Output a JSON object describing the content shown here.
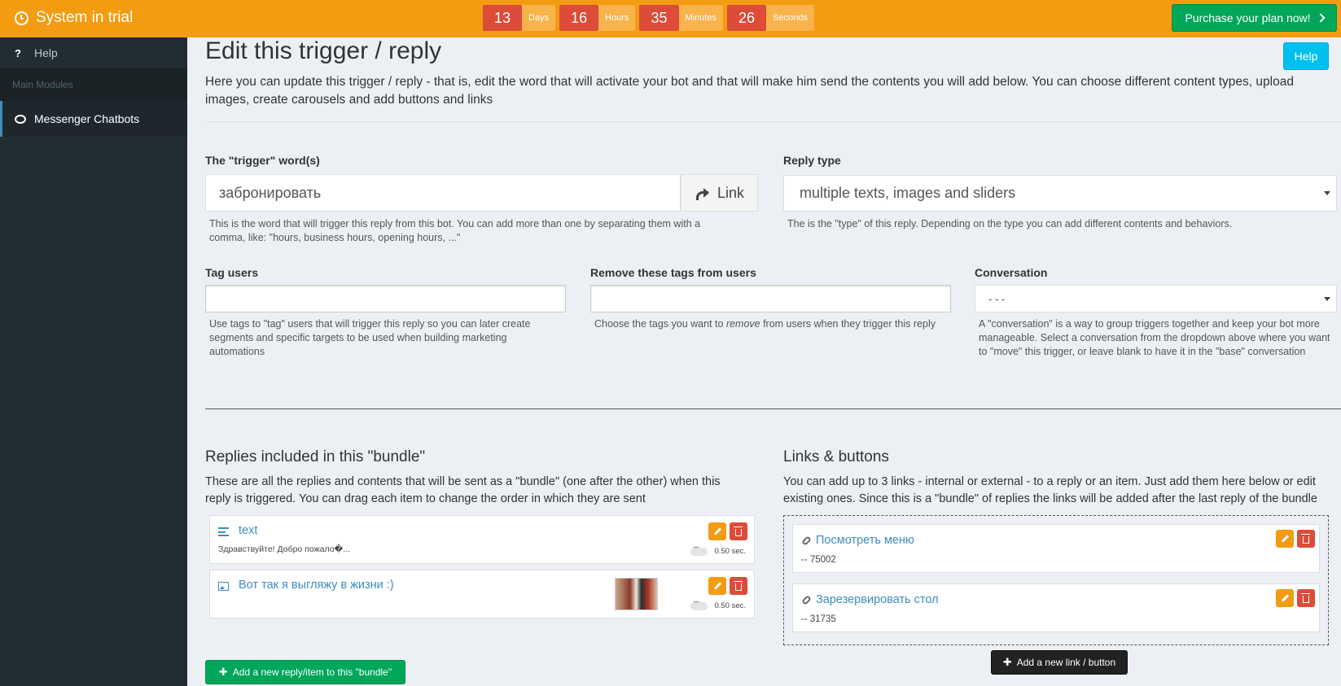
{
  "topbar": {
    "title": "System in trial",
    "countdown": [
      {
        "value": "13",
        "unit": "Days"
      },
      {
        "value": "16",
        "unit": "Hours"
      },
      {
        "value": "35",
        "unit": "Minutes"
      },
      {
        "value": "26",
        "unit": "Seconds"
      }
    ],
    "purchase_label": "Purchase your plan now!"
  },
  "sidebar": {
    "help_label": "Help",
    "header": "Main Modules",
    "active_item": "Messenger Chatbots"
  },
  "page": {
    "title": "Edit this trigger / reply",
    "help_button": "Help",
    "description": "Here you can update this trigger / reply - that is, edit the word that will activate your bot and that will make him send the contents you will add below. You can choose different content types, upload images, create carousels and add buttons and links"
  },
  "form": {
    "trigger_label": "The \"trigger\" word(s)",
    "trigger_value": "забронировать",
    "link_button": "Link",
    "trigger_hint": "This is the word that will trigger this reply from this bot. You can add more than one by separating them with a comma, like: \"hours, business hours, opening hours, ...\"",
    "reply_type_label": "Reply type",
    "reply_type_value": "multiple texts, images and sliders",
    "reply_type_hint": "The is the \"type\" of this reply. Depending on the type you can add different contents and behaviors.",
    "tag_users_label": "Tag users",
    "tag_users_hint": "Use tags to \"tag\" users that will trigger this reply so you can later create segments and specific targets to be used when building marketing automations",
    "remove_tags_label": "Remove these tags from users",
    "remove_tags_hint_pre": "Choose the tags you want to ",
    "remove_tags_hint_em": "remove",
    "remove_tags_hint_post": " from users when they trigger this reply",
    "conversation_label": "Conversation",
    "conversation_value": "- - -",
    "conversation_hint": "A \"conversation\" is a way to group triggers together and keep your bot more manageable. Select a conversation from the dropdown above where you want to \"move\" this trigger, or leave blank to have it in the \"base\" conversation"
  },
  "bundle": {
    "title": "Replies included in this \"bundle\"",
    "description": "These are all the replies and contents that will be sent as a \"bundle\" (one after the other) when this reply is triggered. You can drag each item to change the order in which they are sent",
    "items": [
      {
        "icon": "text-lines-icon",
        "title": "text",
        "subtitle": "Здравствуйте! Добро пожало�...",
        "delay": "0.50 sec."
      },
      {
        "icon": "image-icon",
        "title": "Вот так я выгляжу в жизни :)",
        "subtitle": "",
        "delay": "0.50 sec."
      }
    ],
    "add_button": "Add a new reply/item to this \"bundle\""
  },
  "links": {
    "title": "Links & buttons",
    "description": "You can add up to 3 links - internal or external - to a reply or an item. Just add them here below or edit existing ones. Since this is a \"bundle\" of replies the links will be added after the last reply of the bundle",
    "items": [
      {
        "title": "Посмотреть меню",
        "subtitle": "-- 75002"
      },
      {
        "title": "Зарезервировать стол",
        "subtitle": "-- 31735"
      }
    ],
    "add_button": "Add a new link / button"
  },
  "colors": {
    "topbar": "#f39c12",
    "sidebar": "#222d32",
    "accent": "#3c8dbc",
    "success": "#00a65a",
    "danger": "#dd4b39",
    "info": "#00c0ef"
  }
}
